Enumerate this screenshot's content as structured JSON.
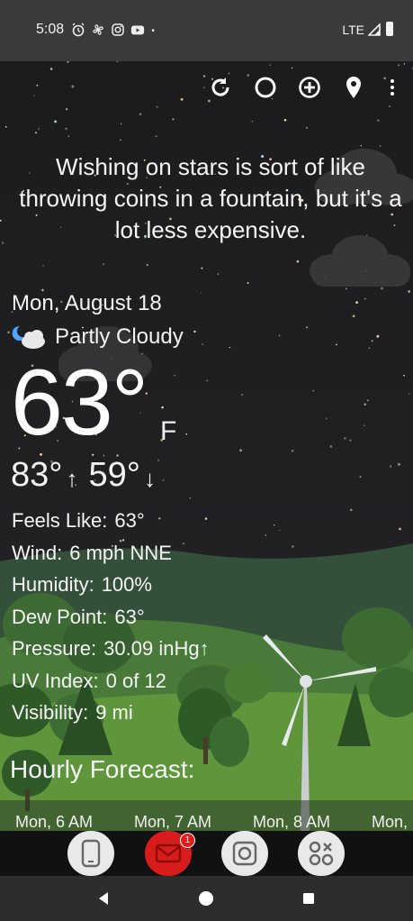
{
  "status_bar": {
    "time": "5:08",
    "icons": [
      "alarm-icon",
      "fan-icon",
      "instagram-icon",
      "youtube-icon",
      "dot-icon"
    ],
    "network": "LTE"
  },
  "toolbar": {
    "buttons": [
      "refresh-icon",
      "theme-icon",
      "add-location-icon",
      "location-pin-icon",
      "more-vert-icon"
    ]
  },
  "quote": "Wishing on stars is sort of like throwing coins in a fountain, but it's a lot less expensive.",
  "weather": {
    "date": "Mon, August 18",
    "condition": "Partly Cloudy",
    "condition_icon": "partly-cloudy-night-icon",
    "temperature": "63°",
    "unit": "F",
    "high": "83°",
    "low": "59°"
  },
  "details": [
    {
      "label": "Feels Like:",
      "value": "63°"
    },
    {
      "label": "Wind:",
      "value": "6 mph NNE"
    },
    {
      "label": "Humidity:",
      "value": "100%"
    },
    {
      "label": "Dew Point:",
      "value": "63°"
    },
    {
      "label": "Pressure:",
      "value": "30.09 inHg↑"
    },
    {
      "label": "UV Index:",
      "value": "0 of 12"
    },
    {
      "label": "Visibility:",
      "value": "9 mi"
    }
  ],
  "hourly": {
    "title": "Hourly Forecast:",
    "items": [
      "Mon, 6 AM",
      "Mon, 7 AM",
      "Mon, 8 AM",
      "Mon,"
    ]
  },
  "dock": {
    "apps": [
      "phone-app-icon",
      "mail-app-icon",
      "camera-app-icon",
      "apps-app-icon"
    ],
    "mail_badge": "1",
    "mail_color": "#d81b1b"
  },
  "nav": [
    "back-icon",
    "home-icon",
    "recents-icon"
  ]
}
